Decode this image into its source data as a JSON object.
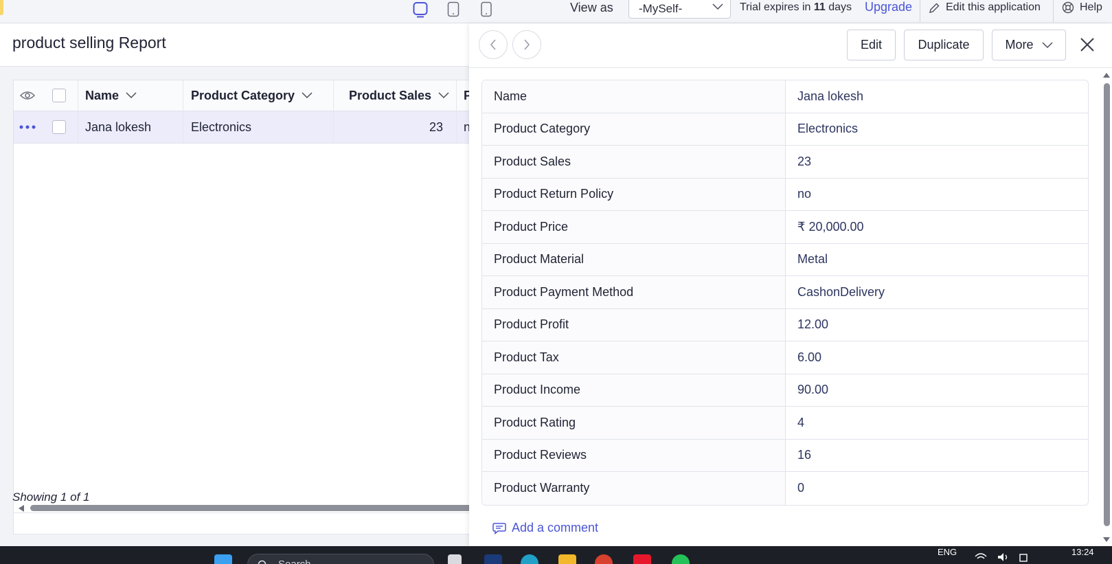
{
  "topbar": {
    "devices": [
      "desktop-icon",
      "tablet-icon",
      "mobile-icon"
    ],
    "view_as_label": "View as",
    "view_as_value": "-MySelf-",
    "trial_prefix": "Trial expires in ",
    "trial_days": "11",
    "trial_suffix": " days",
    "upgrade": "Upgrade",
    "edit_app": "Edit this application",
    "help": "Help"
  },
  "report": {
    "title": "product selling Report",
    "columns": [
      "Name",
      "Product Category",
      "Product Sales",
      "Pro"
    ],
    "row": {
      "name": "Jana lokesh",
      "category": "Electronics",
      "sales": "23",
      "policy": "no"
    },
    "showing": "Showing 1 of 1"
  },
  "panel": {
    "buttons": {
      "edit": "Edit",
      "duplicate": "Duplicate",
      "more": "More"
    },
    "fields": [
      {
        "label": "Name",
        "value": "Jana lokesh"
      },
      {
        "label": "Product Category",
        "value": "Electronics"
      },
      {
        "label": "Product Sales",
        "value": "23"
      },
      {
        "label": "Product Return Policy",
        "value": "no"
      },
      {
        "label": "Product Price",
        "value": "₹ 20,000.00"
      },
      {
        "label": "Product Material",
        "value": "Metal"
      },
      {
        "label": "Product Payment Method",
        "value": "CashonDelivery"
      },
      {
        "label": "Product Profit",
        "value": "12.00"
      },
      {
        "label": "Product Tax",
        "value": "6.00"
      },
      {
        "label": "Product Income",
        "value": "90.00"
      },
      {
        "label": "Product Rating",
        "value": "4"
      },
      {
        "label": "Product Reviews",
        "value": "16"
      },
      {
        "label": "Product Warranty",
        "value": "0"
      }
    ],
    "add_comment": "Add a comment"
  },
  "taskbar": {
    "search_placeholder": "Search",
    "lang": "ENG",
    "time": "13:24"
  },
  "colors": {
    "accent": "#4a55d6",
    "row_selected": "#ececfb",
    "taskbar": "#1c1f26"
  }
}
